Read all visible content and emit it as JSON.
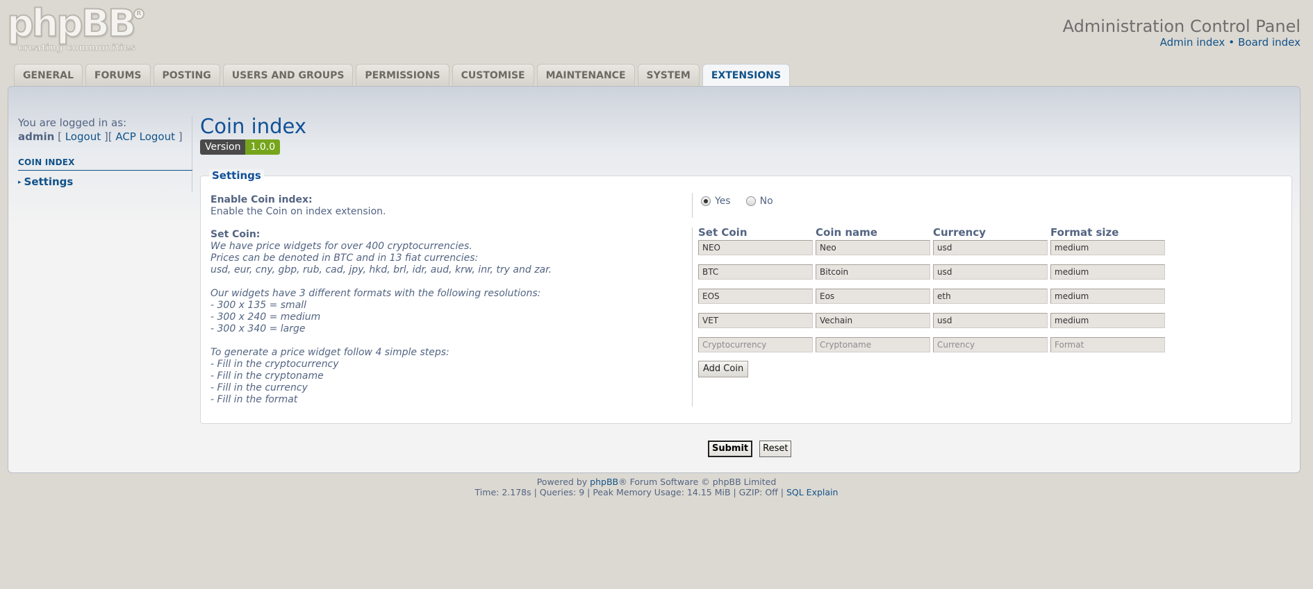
{
  "header": {
    "logo_text": "phpBB",
    "logo_tagline": "creating  communities",
    "title": "Administration Control Panel",
    "links": [
      "Admin index",
      "Board index"
    ],
    "link_separator": "•"
  },
  "tabs": [
    {
      "label": "General"
    },
    {
      "label": "Forums"
    },
    {
      "label": "Posting"
    },
    {
      "label": "Users and Groups"
    },
    {
      "label": "Permissions"
    },
    {
      "label": "Customise"
    },
    {
      "label": "Maintenance"
    },
    {
      "label": "System"
    },
    {
      "label": "Extensions",
      "active": true
    }
  ],
  "sidebar": {
    "logged_in_label": "You are logged in as:",
    "username": "admin",
    "logout_label": "Logout",
    "acp_logout_label": "ACP Logout",
    "section_heading": "COIN INDEX",
    "items": [
      {
        "label": "Settings"
      }
    ]
  },
  "main": {
    "title": "Coin index",
    "version_label": "Version",
    "version_number": "1.0.0",
    "settings_legend": "Settings",
    "enable": {
      "label": "Enable Coin index:",
      "description": "Enable the Coin on index extension.",
      "options": [
        "Yes",
        "No"
      ],
      "selected": "Yes"
    },
    "set_coin": {
      "label": "Set Coin:",
      "description_lines": [
        "We have price widgets for over 400 cryptocurrencies.",
        "Prices can be denoted in BTC and in 13 fiat currencies:",
        "usd, eur, cny, gbp, rub, cad, jpy, hkd, brl, idr, aud, krw, inr, try and zar.",
        "",
        "Our widgets have 3 different formats with the following resolutions:",
        "- 300 x 135 = small",
        "- 300 x 240 = medium",
        "- 300 x 340 = large",
        "",
        "To generate a price widget follow 4 simple steps:",
        "- Fill in the cryptocurrency",
        "- Fill in the cryptoname",
        "- Fill in the currency",
        "- Fill in the format"
      ]
    },
    "coin_table": {
      "headers": [
        "Set Coin",
        "Coin name",
        "Currency",
        "Format size"
      ],
      "rows": [
        [
          "NEO",
          "Neo",
          "usd",
          "medium"
        ],
        [
          "BTC",
          "Bitcoin",
          "usd",
          "medium"
        ],
        [
          "EOS",
          "Eos",
          "eth",
          "medium"
        ],
        [
          "VET",
          "Vechain",
          "usd",
          "medium"
        ]
      ],
      "placeholders": [
        "Cryptocurrency",
        "Cryptoname",
        "Currency",
        "Format"
      ],
      "add_button": "Add Coin"
    },
    "submit_label": "Submit",
    "reset_label": "Reset"
  },
  "footer": {
    "powered_prefix": "Powered by ",
    "phpbb_link": "phpBB",
    "powered_suffix": "® Forum Software © phpBB Limited",
    "stats": "Time: 2.178s | Queries: 9 | Peak Memory Usage: 14.15 MiB | GZIP: Off | ",
    "sql_explain": "SQL Explain"
  }
}
